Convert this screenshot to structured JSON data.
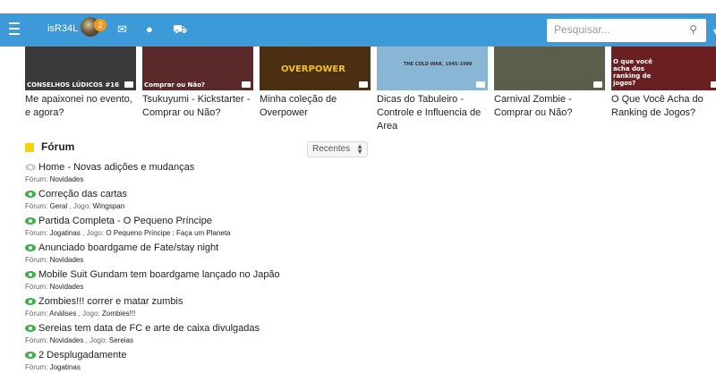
{
  "topbar": {
    "username": "isR34L",
    "notification_count": "2",
    "search_placeholder": "Pesquisar..."
  },
  "videos": [
    {
      "title": "Me apaixonei no evento, e agora?",
      "thumb_text": "CONSELHOS LÚDICOS #16",
      "bg": "#3a3a3a"
    },
    {
      "title": "Tsukuyumi - Kickstarter - Comprar ou Não?",
      "thumb_text": "Comprar ou Não?",
      "bg": "#5a2a2a"
    },
    {
      "title": "Minha coleção de Overpower",
      "thumb_text": "OVERPOWER",
      "bg": "#4a2f12"
    },
    {
      "title": "Dicas do Tabuleiro - Controle e Influencia de Area",
      "thumb_text": "THE COLD WAR, 1945-1989",
      "bg": "#8ab6d6"
    },
    {
      "title": "Carnival Zombie - Comprar ou Não?",
      "thumb_text": "",
      "bg": "#5b5e4a"
    },
    {
      "title": "O Que Você Acha do Ranking de Jogos?",
      "thumb_text": "O que você acha dos ranking de jogos?",
      "bg": "#6a2020"
    }
  ],
  "forum": {
    "title": "Fórum",
    "sort_selected": "Recentes",
    "label_forum": "Fórum:",
    "label_jogo": "Jogo:",
    "topics": [
      {
        "title": "Home - Novas adições e mudanças",
        "forum": "Novidades",
        "jogo": "",
        "seen": true
      },
      {
        "title": "Correção das cartas",
        "forum": "Geral",
        "jogo": "Wingspan",
        "seen": false
      },
      {
        "title": "Partida Completa - O Pequeno Príncipe",
        "forum": "Jogatinas",
        "jogo": "O Pequeno Príncipe : Faça um Planeta",
        "seen": false
      },
      {
        "title": "Anunciado boardgame de Fate/stay night",
        "forum": "Novidades",
        "jogo": "",
        "seen": false
      },
      {
        "title": "Mobile Suit Gundam tem boardgame lançado no Japão",
        "forum": "Novidades",
        "jogo": "",
        "seen": false
      },
      {
        "title": "Zombies!!! correr e matar zumbis",
        "forum": "Análises",
        "jogo": "Zombies!!!",
        "seen": false
      },
      {
        "title": "Sereias tem data de FC e arte de caixa divulgadas",
        "forum": "Novidades",
        "jogo": "Sereias",
        "seen": false
      },
      {
        "title": "2 Desplugadamente",
        "forum": "Jogatinas",
        "jogo": "",
        "seen": false
      }
    ]
  }
}
